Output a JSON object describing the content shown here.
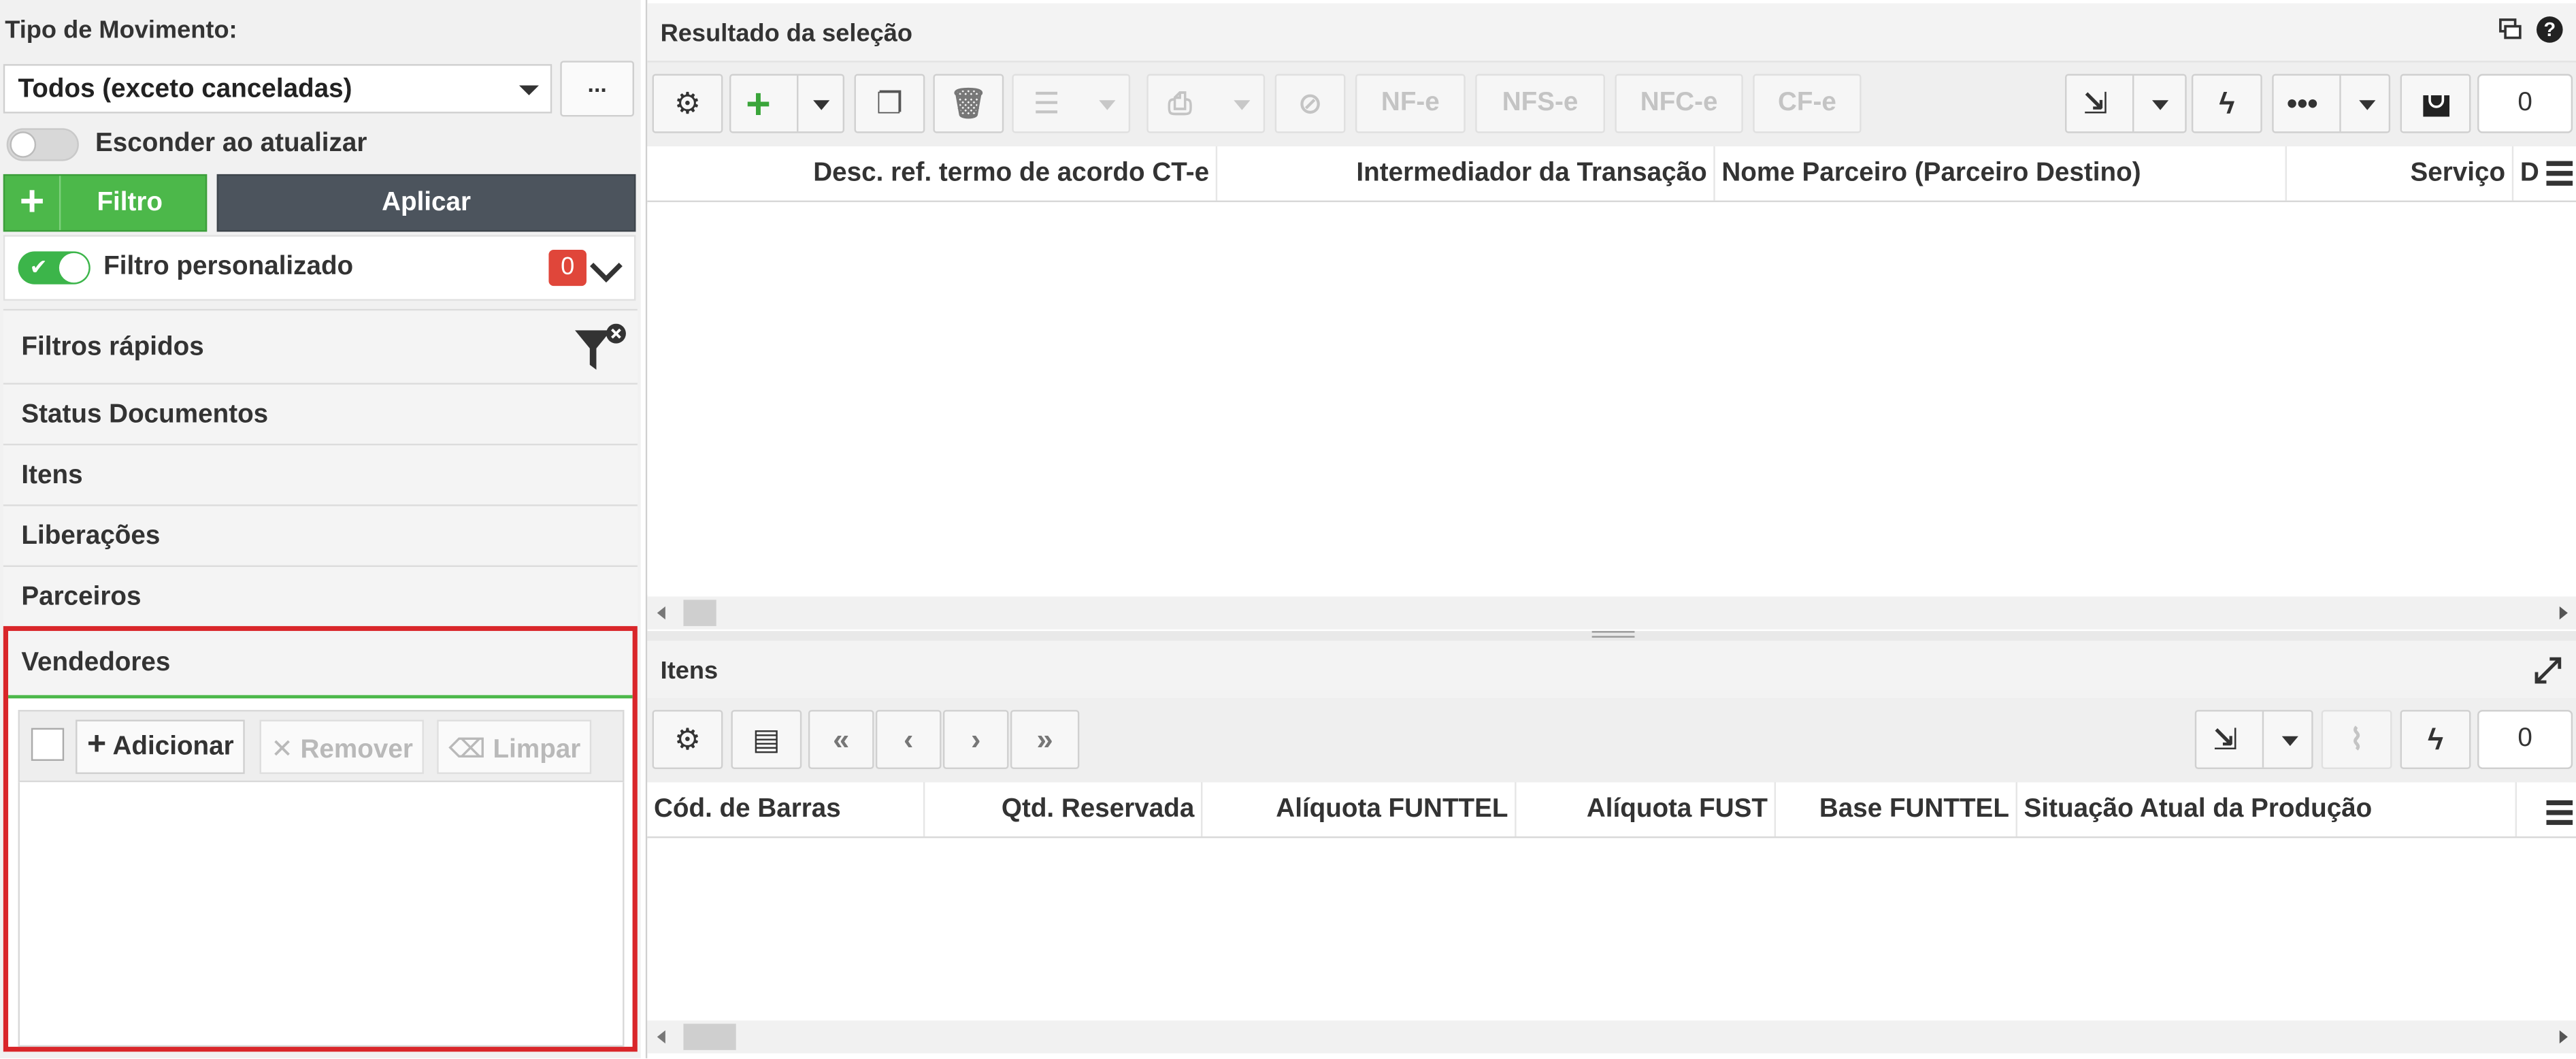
{
  "sidebar": {
    "tipo_label": "Tipo de Movimento:",
    "tipo_value": "Todos (exceto canceladas)",
    "dots_label": "...",
    "hide_label": "Esconder ao atualizar",
    "filtro_label": "Filtro",
    "aplicar_label": "Aplicar",
    "custom_filter_label": "Filtro personalizado",
    "custom_filter_count": "0",
    "sections": [
      {
        "label": "Filtros rápidos"
      },
      {
        "label": "Status Documentos"
      },
      {
        "label": "Itens"
      },
      {
        "label": "Liberações"
      },
      {
        "label": "Parceiros"
      }
    ],
    "vendedores": {
      "title": "Vendedores",
      "add_label": "Adicionar",
      "remove_label": "Remover",
      "clear_label": "Limpar"
    }
  },
  "result": {
    "title": "Resultado da seleção",
    "doc_buttons": [
      "NF-e",
      "NFS-e",
      "NFC-e",
      "CF-e"
    ],
    "count": "0",
    "columns": [
      "Desc. ref. termo de acordo CT-e",
      "Intermediador da Transação",
      "Nome Parceiro (Parceiro Destino)",
      "Serviço",
      "D"
    ]
  },
  "items": {
    "title": "Itens",
    "count": "0",
    "columns": [
      "Cód. de Barras",
      "Qtd. Reservada",
      "Alíquota FUNTTEL",
      "Alíquota FUST",
      "Base FUNTTEL",
      "Situação Atual da Produção"
    ]
  },
  "colors": {
    "green": "#4cb84a",
    "dark": "#4c545d",
    "badge": "#e0463a",
    "highlight": "#d9262a"
  },
  "icons": [
    "gear-icon",
    "plus-icon",
    "copy-icon",
    "trash-icon",
    "list-icon",
    "print-icon",
    "export-icon",
    "lightning-icon",
    "ellipsis-icon",
    "bag-icon",
    "funnel-clear-icon",
    "window-icon",
    "help-icon",
    "expand-icon",
    "paperclip-icon",
    "first-page-icon",
    "prev-page-icon",
    "next-page-icon",
    "last-page-icon",
    "columns-menu-icon"
  ]
}
